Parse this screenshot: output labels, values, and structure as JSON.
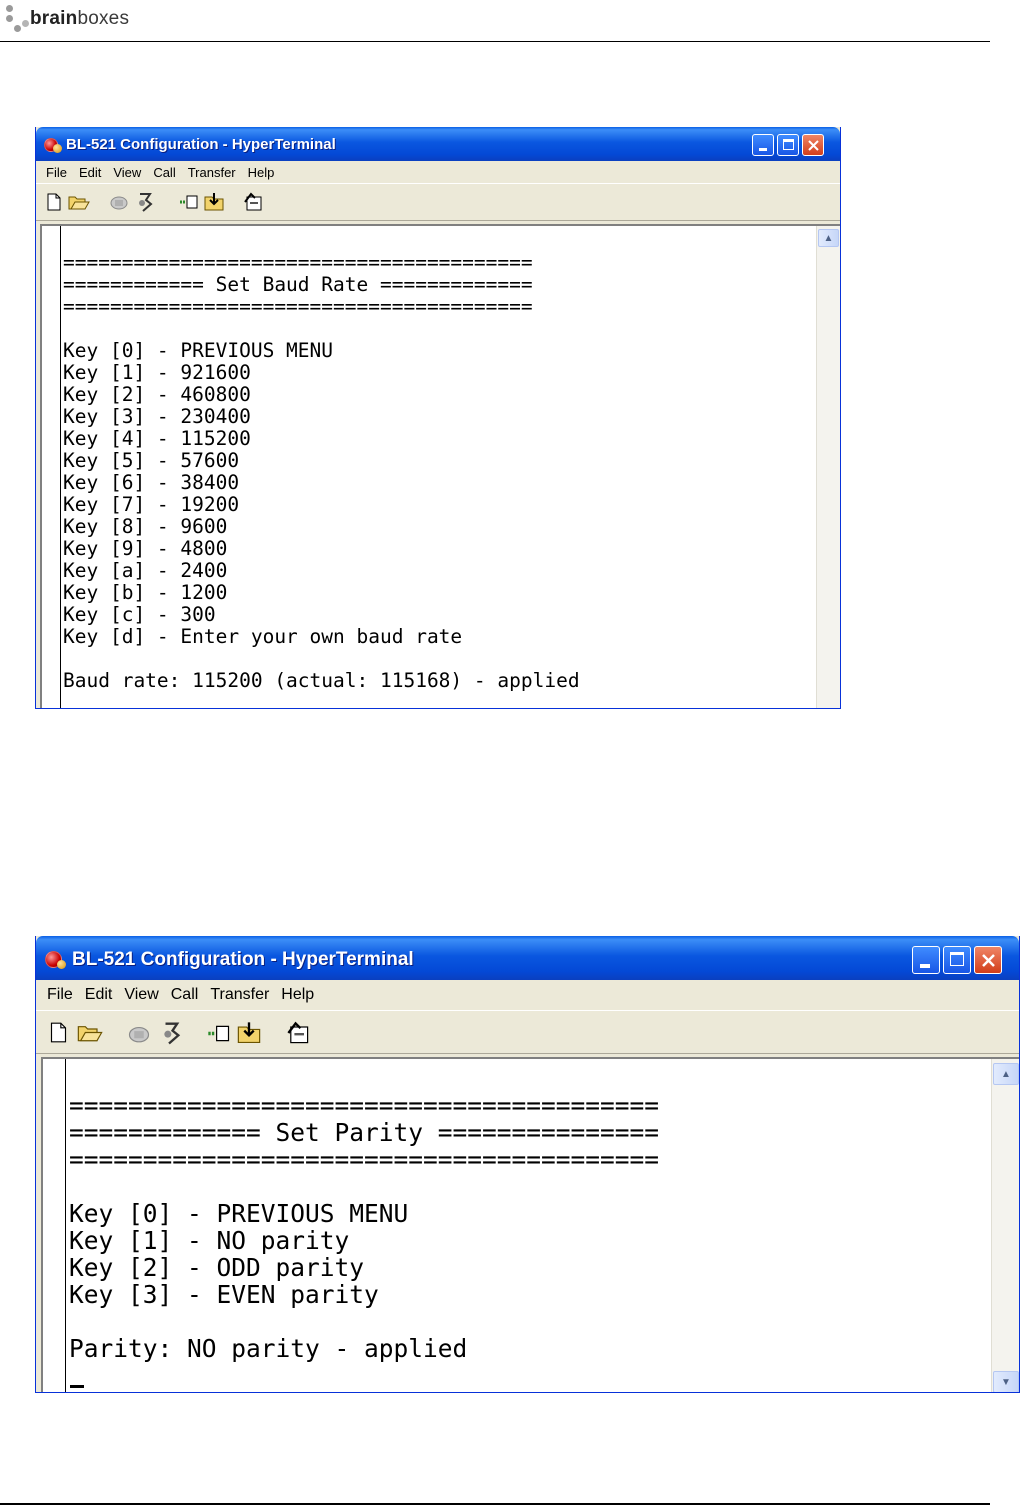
{
  "document": {
    "logo": {
      "bold": "brain",
      "regular": "boxes"
    }
  },
  "icons": {
    "app": "hyperterminal-icon",
    "minimize": "minimize-icon",
    "maximize": "maximize-icon",
    "close": "close-icon",
    "new": "new-document-icon",
    "open": "open-folder-icon",
    "disconnect": "disconnect-phone-icon",
    "call": "call-phone-icon",
    "send": "send-file-icon",
    "receive": "receive-file-icon",
    "properties": "properties-icon",
    "scroll_up": "scroll-up-arrow-icon",
    "scroll_down": "scroll-down-arrow-icon"
  },
  "colors": {
    "titlebar": "#0a57e0",
    "terminal_bg": "#ffffff",
    "chrome": "#ece9d8"
  },
  "window1": {
    "title": "BL-521 Configuration - HyperTerminal",
    "menu": [
      "File",
      "Edit",
      "View",
      "Call",
      "Transfer",
      "Help"
    ],
    "lines": [
      "",
      "========================================",
      "============ Set Baud Rate =============",
      "========================================",
      "",
      "Key [0] - PREVIOUS MENU",
      "Key [1] - 921600",
      "Key [2] - 460800",
      "Key [3] - 230400",
      "Key [4] - 115200",
      "Key [5] - 57600",
      "Key [6] - 38400",
      "Key [7] - 19200",
      "Key [8] - 9600",
      "Key [9] - 4800",
      "Key [a] - 2400",
      "Key [b] - 1200",
      "Key [c] - 300",
      "Key [d] - Enter your own baud rate",
      "",
      "Baud rate: 115200 (actual: 115168) - applied"
    ]
  },
  "window2": {
    "title": "BL-521 Configuration - HyperTerminal",
    "menu": [
      "File",
      "Edit",
      "View",
      "Call",
      "Transfer",
      "Help"
    ],
    "lines": [
      "",
      "========================================",
      "============= Set Parity ===============",
      "========================================",
      "",
      "Key [0] - PREVIOUS MENU",
      "Key [1] - NO parity",
      "Key [2] - ODD parity",
      "Key [3] - EVEN parity",
      "",
      "Parity: NO parity - applied"
    ]
  }
}
